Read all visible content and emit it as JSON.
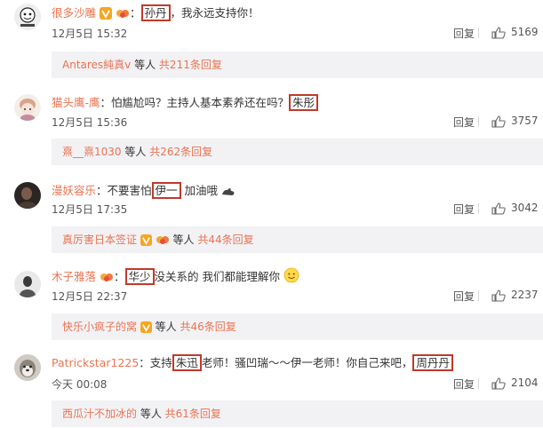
{
  "reply_label": "回复",
  "comments": [
    {
      "username": "很多沙雕",
      "pre": "：",
      "highlight1": "孙丹",
      "post": "，我永远支持你！",
      "time": "12月5日 15:32",
      "likes": "5169",
      "thread_user": "Antares純真v",
      "thread_etc": " 等人 ",
      "thread_count": "共211条回复"
    },
    {
      "username": "猫头鹰-鹰",
      "pre": "：怕尴尬吗？主持人基本素养还在吗？",
      "highlight1": "朱彤",
      "time": "12月5日 15:36",
      "likes": "3757",
      "thread_user": "熹__熹1030",
      "thread_etc": " 等人 ",
      "thread_count": "共262条回复"
    },
    {
      "username": "漫妖容乐",
      "pre": "：不要害怕",
      "highlight1": "伊一",
      "post": "  加油哦",
      "time": "12月5日 17:35",
      "likes": "3042",
      "thread_user": "真厉害日本签证",
      "thread_etc": " 等人 ",
      "thread_count": "共44条回复"
    },
    {
      "username": "木子雅落",
      "pre": "：",
      "highlight1": "华少",
      "post": "没关系的 我们都能理解你",
      "time": "12月5日 22:37",
      "likes": "2237",
      "thread_user": "快乐小疯子的窝",
      "thread_etc": " 等人 ",
      "thread_count": "共46条回复"
    },
    {
      "username": "Patrickstar1225",
      "pre": "：支持",
      "highlight1": "朱迅",
      "mid": "老师！骚凹瑞～～伊一老师！你自己来吧，",
      "highlight2": "周丹丹",
      "time": "今天 00:08",
      "likes": "2104",
      "thread_user": "西瓜汁不加冰的",
      "thread_etc": " 等人 ",
      "thread_count": "共61条回复"
    }
  ]
}
